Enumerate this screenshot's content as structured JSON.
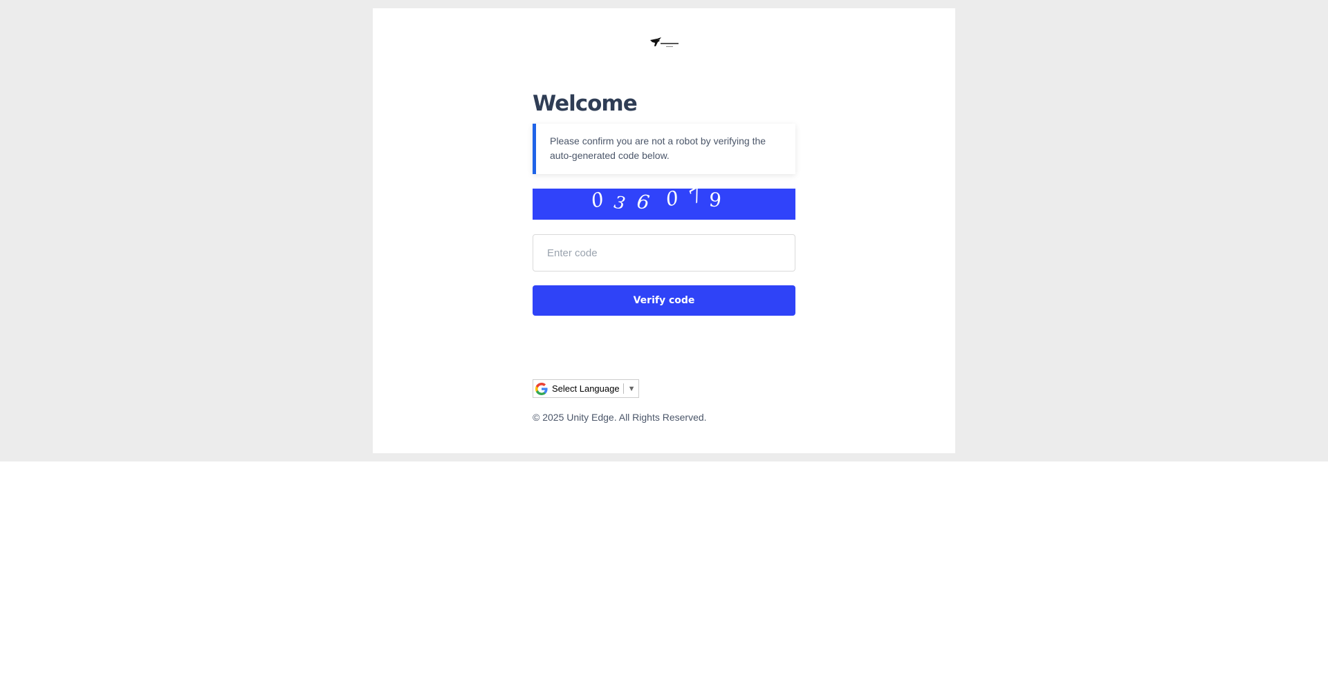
{
  "header": {
    "logo_icon": "bird-logo-icon"
  },
  "main": {
    "title": "Welcome",
    "notice": "Please confirm you are not a robot by verifying the auto-generated code below.",
    "captcha": {
      "chars": [
        "0",
        "3",
        "6",
        "0",
        "7",
        "9"
      ],
      "background": "#3043fa"
    },
    "code_input": {
      "value": "",
      "placeholder": "Enter code"
    },
    "verify_button": "Verify code",
    "accent_color": "#2f43f7"
  },
  "footer": {
    "language": {
      "label": "Select Language",
      "arrow": "▼",
      "icon": "google-icon"
    },
    "copyright": "© 2025 Unity Edge. All Rights Reserved."
  }
}
